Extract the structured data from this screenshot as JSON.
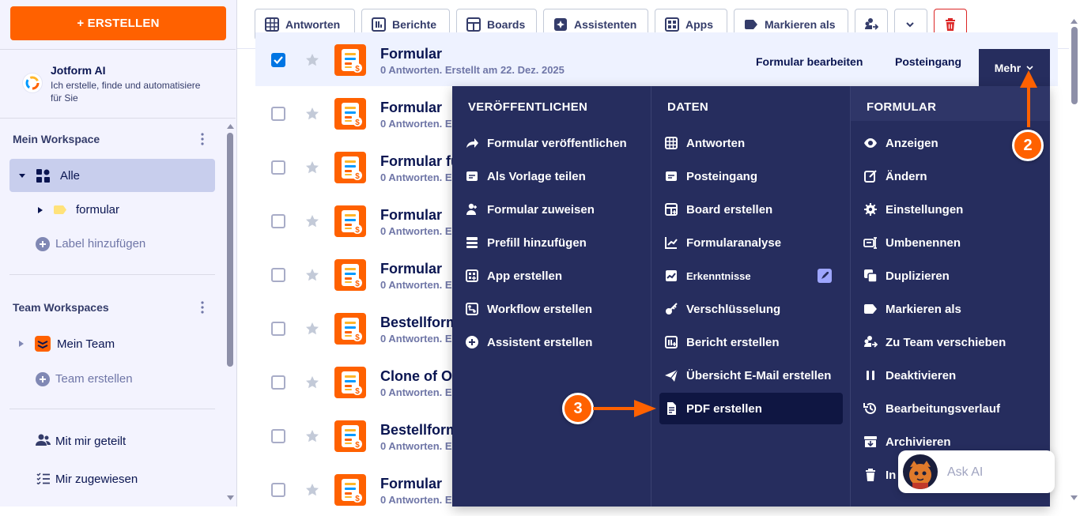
{
  "sidebar": {
    "create_label": "+ ERSTELLEN",
    "ai_title": "Jotform AI",
    "ai_subtitle": "Ich erstelle, finde und automatisiere für Sie",
    "my_workspace": "Mein Workspace",
    "all_label": "Alle",
    "folder_label": "formular",
    "add_label": "Label hinzufügen",
    "team_workspaces": "Team Workspaces",
    "my_team": "Mein Team",
    "create_team": "Team erstellen",
    "shared_with_me": "Mit mir geteilt",
    "assigned_to_me": "Mir zugewiesen"
  },
  "toolbar": {
    "submissions": "Antworten",
    "reports": "Berichte",
    "boards": "Boards",
    "agents": "Assistenten",
    "apps": "Apps",
    "mark_as": "Markieren als"
  },
  "rows": [
    {
      "title": "Formular",
      "sub": "0 Antworten. Erstellt am 22. Dez. 2025",
      "selected": true
    },
    {
      "title": "Formular",
      "sub": "0 Antworten. E"
    },
    {
      "title": "Formular fü",
      "sub": "0 Antworten. E"
    },
    {
      "title": "Formular",
      "sub": "0 Antworten. E"
    },
    {
      "title": "Formular",
      "sub": "0 Antworten. E"
    },
    {
      "title": "Bestellform",
      "sub": "0 Antworten. E"
    },
    {
      "title": "Clone of Or",
      "sub": "0 Antworten. E"
    },
    {
      "title": "Bestellform",
      "sub": "0 Antworten. E"
    },
    {
      "title": "Formular",
      "sub": "0 Antworten. E"
    }
  ],
  "row_actions": {
    "edit": "Formular bearbeiten",
    "inbox": "Posteingang",
    "more": "Mehr"
  },
  "menu": {
    "publish": {
      "heading": "VERÖFFENTLICHEN",
      "items": [
        "Formular veröffentlichen",
        "Als Vorlage teilen",
        "Formular zuweisen",
        "Prefill hinzufügen",
        "App erstellen",
        "Workflow erstellen",
        "Assistent erstellen"
      ]
    },
    "data": {
      "heading": "DATEN",
      "items": [
        "Antworten",
        "Posteingang",
        "Board erstellen",
        "Formularanalyse",
        "Erkenntnisse",
        "Verschlüsselung",
        "Bericht erstellen",
        "Übersicht E-Mail erstellen",
        "PDF erstellen"
      ]
    },
    "form": {
      "heading": "FORMULAR",
      "items": [
        "Anzeigen",
        "Ändern",
        "Einstellungen",
        "Umbenennen",
        "Duplizieren",
        "Markieren als",
        "Zu Team verschieben",
        "Deaktivieren",
        "Bearbeitungsverlauf",
        "Archivieren",
        "In"
      ]
    }
  },
  "annotations": {
    "step2": "2",
    "step3": "3"
  },
  "ask_ai": "Ask AI",
  "colors": {
    "accent": "#ff6100",
    "menu_bg": "#262d5e",
    "selected_row": "#eef2ff",
    "checkbox": "#0075e3"
  }
}
